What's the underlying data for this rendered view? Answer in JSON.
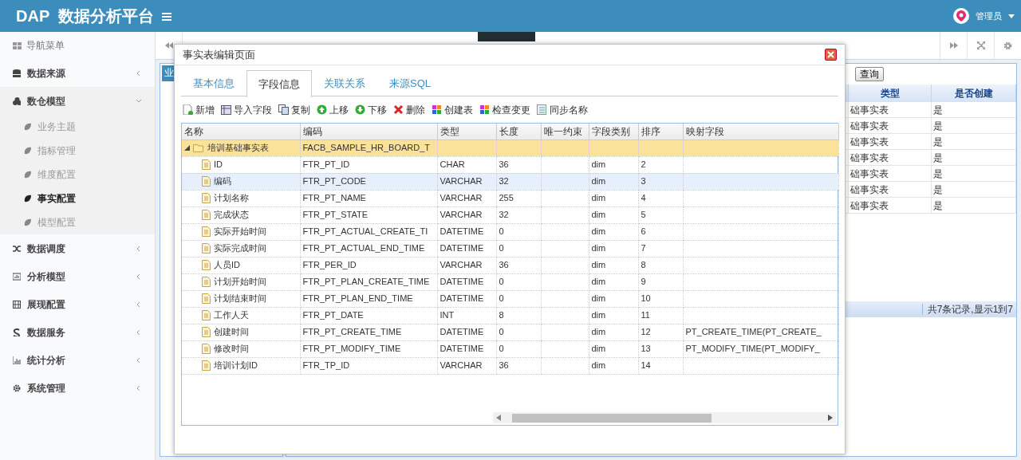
{
  "header": {
    "logo": "DAP  数据分析平台",
    "user": "管理员"
  },
  "sidebar": {
    "title": "导航菜单",
    "items": [
      {
        "label": "数据来源",
        "expanded": false
      },
      {
        "label": "数仓模型",
        "expanded": true,
        "children": [
          {
            "label": "业务主题",
            "selected": false
          },
          {
            "label": "指标管理",
            "selected": false
          },
          {
            "label": "维度配置",
            "selected": false
          },
          {
            "label": "事实配置",
            "selected": true
          },
          {
            "label": "模型配置",
            "selected": false
          }
        ]
      },
      {
        "label": "数据调度",
        "expanded": false
      },
      {
        "label": "分析模型",
        "expanded": false
      },
      {
        "label": "展现配置",
        "expanded": false
      },
      {
        "label": "数据服务",
        "expanded": false
      },
      {
        "label": "统计分析",
        "expanded": false
      },
      {
        "label": "系统管理",
        "expanded": false
      }
    ]
  },
  "background": {
    "tree_tab": "业",
    "query_button": "查询",
    "columns": [
      "类型",
      "是否创建"
    ],
    "rows": [
      [
        "础事实表",
        "是"
      ],
      [
        "础事实表",
        "是"
      ],
      [
        "础事实表",
        "是"
      ],
      [
        "础事实表",
        "是"
      ],
      [
        "础事实表",
        "是"
      ],
      [
        "础事实表",
        "是"
      ],
      [
        "础事实表",
        "是"
      ]
    ],
    "footer": "共7条记录,显示1到7"
  },
  "dialog": {
    "title": "事实表编辑页面",
    "tabs": [
      {
        "label": "基本信息",
        "selected": false
      },
      {
        "label": "字段信息",
        "selected": true
      },
      {
        "label": "关联关系",
        "selected": false
      },
      {
        "label": "来源SQL",
        "selected": false
      }
    ],
    "toolbar": [
      "新增",
      "导入字段",
      "复制",
      "上移",
      "下移",
      "删除",
      "创建表",
      "检查变更",
      "同步名称"
    ],
    "columns": [
      "名称",
      "编码",
      "类型",
      "长度",
      "唯一约束",
      "字段类别",
      "排序",
      "映射字段"
    ],
    "rows": [
      {
        "name": "培训基础事实表",
        "code": "FACB_SAMPLE_HR_BOARD_T",
        "expanded": true,
        "selected": true,
        "children": [
          {
            "name": "ID",
            "code": "FTR_PT_ID",
            "type": "CHAR",
            "length": "36",
            "category": "dim",
            "order": "2",
            "selected": false,
            "highlighted": false
          },
          {
            "name": "编码",
            "code": "FTR_PT_CODE",
            "type": "VARCHAR",
            "length": "32",
            "category": "dim",
            "order": "3",
            "selected": false,
            "highlighted": true
          },
          {
            "name": "计划名称",
            "code": "FTR_PT_NAME",
            "type": "VARCHAR",
            "length": "255",
            "category": "dim",
            "order": "4",
            "selected": false,
            "highlighted": false
          },
          {
            "name": "完成状态",
            "code": "FTR_PT_STATE",
            "type": "VARCHAR",
            "length": "32",
            "category": "dim",
            "order": "5",
            "selected": false,
            "highlighted": false
          },
          {
            "name": "实际开始时间",
            "code": "FTR_PT_ACTUAL_CREATE_TI",
            "type": "DATETIME",
            "length": "0",
            "category": "dim",
            "order": "6",
            "selected": false,
            "highlighted": false
          },
          {
            "name": "实际完成时间",
            "code": "FTR_PT_ACTUAL_END_TIME",
            "type": "DATETIME",
            "length": "0",
            "category": "dim",
            "order": "7",
            "selected": false,
            "highlighted": false
          },
          {
            "name": "人员ID",
            "code": "FTR_PER_ID",
            "type": "VARCHAR",
            "length": "36",
            "category": "dim",
            "order": "8",
            "selected": false,
            "highlighted": false
          },
          {
            "name": "计划开始时间",
            "code": "FTR_PT_PLAN_CREATE_TIME",
            "type": "DATETIME",
            "length": "0",
            "category": "dim",
            "order": "9",
            "selected": false,
            "highlighted": false
          },
          {
            "name": "计划结束时间",
            "code": "FTR_PT_PLAN_END_TIME",
            "type": "DATETIME",
            "length": "0",
            "category": "dim",
            "order": "10",
            "selected": false,
            "highlighted": false
          },
          {
            "name": "工作人天",
            "code": "FTR_PT_DATE",
            "type": "INT",
            "length": "8",
            "category": "dim",
            "order": "11",
            "selected": false,
            "highlighted": false
          },
          {
            "name": "创建时间",
            "code": "FTR_PT_CREATE_TIME",
            "type": "DATETIME",
            "length": "0",
            "category": "dim",
            "order": "12",
            "mapping": "PT_CREATE_TIME(PT_CREATE_",
            "selected": false,
            "highlighted": false
          },
          {
            "name": "修改时间",
            "code": "FTR_PT_MODIFY_TIME",
            "type": "DATETIME",
            "length": "0",
            "category": "dim",
            "order": "13",
            "mapping": "PT_MODIFY_TIME(PT_MODIFY_",
            "selected": false,
            "highlighted": false
          },
          {
            "name": "培训计划ID",
            "code": "FTR_TP_ID",
            "type": "VARCHAR",
            "length": "36",
            "category": "dim",
            "order": "14",
            "selected": false,
            "highlighted": false
          }
        ]
      }
    ]
  }
}
